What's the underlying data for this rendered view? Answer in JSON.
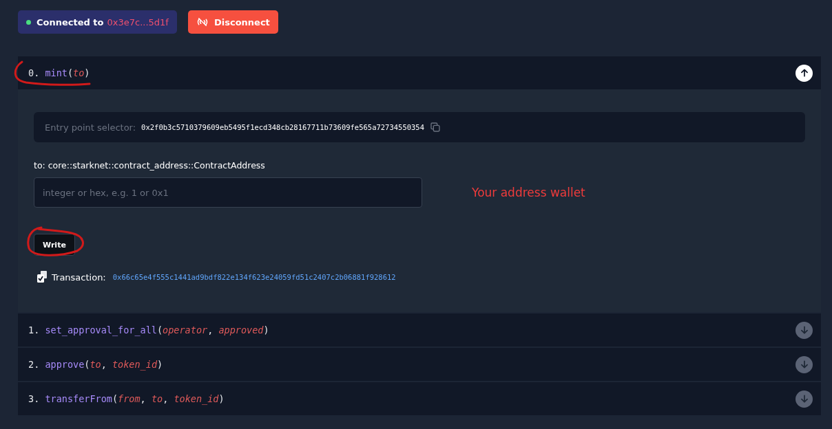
{
  "connection": {
    "label": "Connected to",
    "address": "0x3e7c...5d1f"
  },
  "disconnect_button": {
    "label": "Disconnect"
  },
  "functions": [
    {
      "index": "0.",
      "parts": [
        {
          "kind": "name",
          "text": "mint"
        },
        {
          "kind": "punct",
          "text": "("
        },
        {
          "kind": "param",
          "text": "to"
        },
        {
          "kind": "punct",
          "text": ")"
        }
      ],
      "expanded": true,
      "details": {
        "selector_label": "Entry point selector:",
        "selector": "0x2f0b3c5710379609eb5495f1ecd348cb28167711b73609fe565a72734550354",
        "inputs": [
          {
            "label": "to: core::starknet::contract_address::ContractAddress",
            "placeholder": "integer or hex, e.g. 1 or 0x1"
          }
        ],
        "write_button": "Write",
        "transaction_label": "Transaction:",
        "transaction_hash": "0x66c65e4f555c1441ad9bdf822e134f623e24059fd51c2407c2b06881f928612"
      }
    },
    {
      "index": "1.",
      "parts": [
        {
          "kind": "name",
          "text": "set_approval_for_all"
        },
        {
          "kind": "punct",
          "text": "("
        },
        {
          "kind": "param",
          "text": "operator"
        },
        {
          "kind": "punct",
          "text": ", "
        },
        {
          "kind": "param",
          "text": "approved"
        },
        {
          "kind": "punct",
          "text": ")"
        }
      ],
      "expanded": false
    },
    {
      "index": "2.",
      "parts": [
        {
          "kind": "name",
          "text": "approve"
        },
        {
          "kind": "punct",
          "text": "("
        },
        {
          "kind": "param",
          "text": "to"
        },
        {
          "kind": "punct",
          "text": ", "
        },
        {
          "kind": "param",
          "text": "token_id"
        },
        {
          "kind": "punct",
          "text": ")"
        }
      ],
      "expanded": false
    },
    {
      "index": "3.",
      "parts": [
        {
          "kind": "name",
          "text": "transferFrom"
        },
        {
          "kind": "punct",
          "text": "("
        },
        {
          "kind": "param",
          "text": "from"
        },
        {
          "kind": "punct",
          "text": ", "
        },
        {
          "kind": "param",
          "text": "to"
        },
        {
          "kind": "punct",
          "text": ", "
        },
        {
          "kind": "param",
          "text": "token_id"
        },
        {
          "kind": "punct",
          "text": ")"
        }
      ],
      "expanded": false
    }
  ],
  "annotation": {
    "text": "Your address wallet"
  }
}
